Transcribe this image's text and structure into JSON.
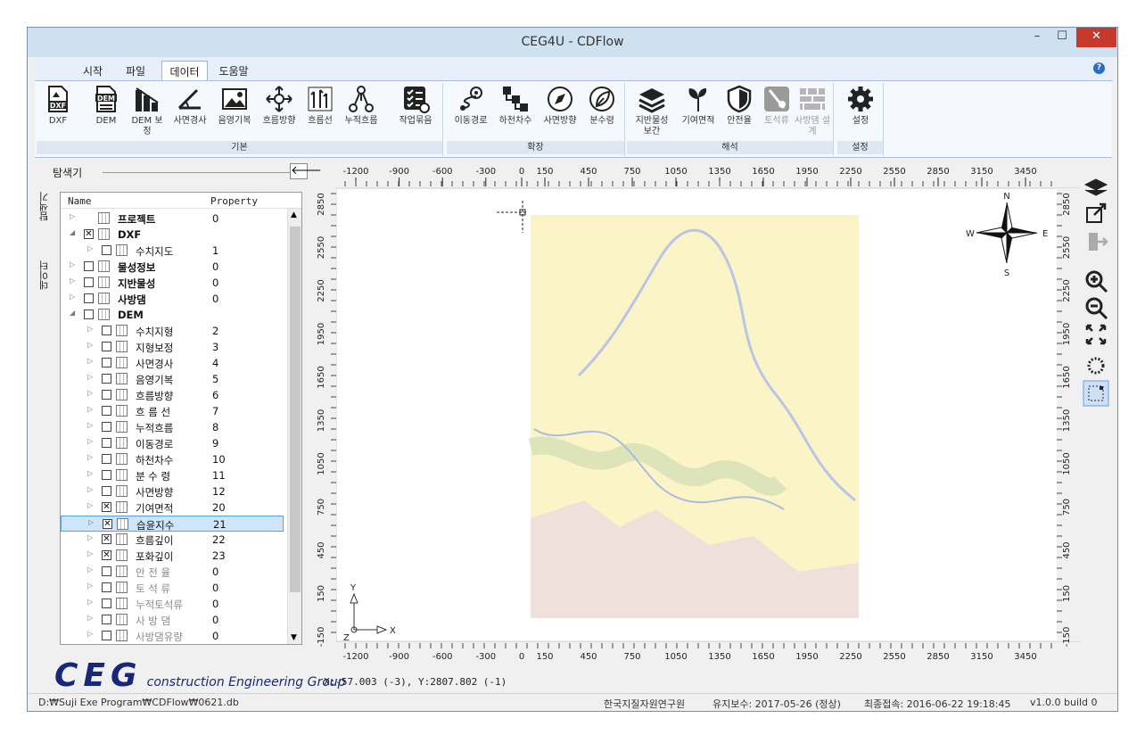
{
  "window": {
    "title": "CEG4U - CDFlow",
    "minimize": "–",
    "maximize": "☐",
    "close": "✕"
  },
  "menu": [
    "시작",
    "파일",
    "데이터",
    "도움말"
  ],
  "help_icon": "?",
  "ribbon": {
    "basic": {
      "label": "기본",
      "buttons": [
        "DXF",
        "DEM",
        "DEM 보정",
        "사면경사",
        "음영기복",
        "흐름방향",
        "흐름선",
        "누적흐름",
        "작업묶음"
      ]
    },
    "extend": {
      "label": "확장",
      "buttons": [
        "이동경로",
        "하천차수",
        "사면방향",
        "분수령"
      ]
    },
    "analysis": {
      "label": "해석",
      "buttons": [
        "지반물성 보간",
        "기여면적",
        "안전율",
        "토석류",
        "사방댐 설계"
      ]
    },
    "settings": {
      "label": "설정",
      "buttons": [
        "설정"
      ]
    }
  },
  "explorer": {
    "title": "탐색기",
    "back": "🡐",
    "vtabs": [
      "탐색기",
      "데이터"
    ],
    "columns": [
      "Name",
      "Property"
    ],
    "rows": [
      {
        "name": "프로젝트",
        "value": "0",
        "level": 0,
        "bold": true,
        "checked": false,
        "nocb": true
      },
      {
        "name": "DXF",
        "value": "",
        "level": 0,
        "bold": true,
        "checked": true,
        "open": true
      },
      {
        "name": "수치지도",
        "value": "1",
        "level": 1
      },
      {
        "name": "물성정보",
        "value": "0",
        "level": 0,
        "bold": true
      },
      {
        "name": "지반물성",
        "value": "0",
        "level": 0,
        "bold": true
      },
      {
        "name": "사방댐",
        "value": "0",
        "level": 0,
        "bold": true
      },
      {
        "name": "DEM",
        "value": "",
        "level": 0,
        "bold": true,
        "open": true
      },
      {
        "name": "수치지형",
        "value": "2",
        "level": 1
      },
      {
        "name": "지형보정",
        "value": "3",
        "level": 1
      },
      {
        "name": "사면경사",
        "value": "4",
        "level": 1
      },
      {
        "name": "음영기복",
        "value": "5",
        "level": 1
      },
      {
        "name": "흐름방향",
        "value": "6",
        "level": 1
      },
      {
        "name": "흐 름 선",
        "value": "7",
        "level": 1
      },
      {
        "name": "누적흐름",
        "value": "8",
        "level": 1
      },
      {
        "name": "이동경로",
        "value": "9",
        "level": 1
      },
      {
        "name": "하천차수",
        "value": "10",
        "level": 1
      },
      {
        "name": "분 수 령",
        "value": "11",
        "level": 1
      },
      {
        "name": "사면방향",
        "value": "12",
        "level": 1
      },
      {
        "name": "기여면적",
        "value": "20",
        "level": 1,
        "checked": true
      },
      {
        "name": "습윤지수",
        "value": "21",
        "level": 1,
        "checked": true,
        "selected": true
      },
      {
        "name": "흐름깊이",
        "value": "22",
        "level": 1,
        "checked": true
      },
      {
        "name": "포화깊이",
        "value": "23",
        "level": 1,
        "checked": true
      },
      {
        "name": "안 전 율",
        "value": "0",
        "level": 1,
        "gray": true
      },
      {
        "name": "토 석 류",
        "value": "0",
        "level": 1,
        "gray": true
      },
      {
        "name": "누적토석류",
        "value": "0",
        "level": 1,
        "gray": true
      },
      {
        "name": "사 방 댐",
        "value": "0",
        "level": 1,
        "gray": true
      },
      {
        "name": "사방댐유량",
        "value": "0",
        "level": 1,
        "gray": true
      }
    ]
  },
  "logo": {
    "big": "CEG",
    "small": "construction Engineering Group"
  },
  "map": {
    "x_ticks": [
      "-1200",
      "-900",
      "-600",
      "-300",
      "0",
      "150",
      "450",
      "750",
      "1050",
      "1350",
      "1650",
      "1950",
      "2250",
      "2550",
      "2850",
      "3150",
      "3450"
    ],
    "y_ticks": [
      "2850",
      "2550",
      "2250",
      "1950",
      "1650",
      "1350",
      "1050",
      "750",
      "450",
      "150",
      "-150"
    ],
    "compass": {
      "n": "N",
      "s": "S",
      "e": "E",
      "w": "W"
    },
    "axes": {
      "x": "X",
      "y": "Y",
      "z": "Z"
    },
    "coord_readout": "X:-57.003 (-3), Y:2807.802 (-1)"
  },
  "status": {
    "path": "D:₩Suji Exe Program₩CDFlow₩0621.db",
    "org": "한국지질자원연구원",
    "maint": "유지보수: 2017-05-26 (정상)",
    "last": "최종접속: 2016-06-22 19:18:45",
    "version": "v1.0.0 build 0"
  }
}
